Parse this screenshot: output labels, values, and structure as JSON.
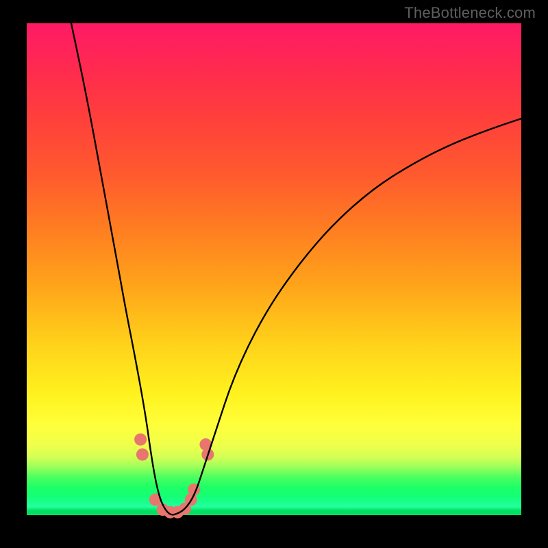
{
  "watermark": "TheBottleneck.com",
  "chart_data": {
    "type": "line",
    "title": "",
    "xlabel": "",
    "ylabel": "",
    "xlim": [
      0,
      100
    ],
    "ylim": [
      0,
      100
    ],
    "grid": false,
    "legend": false,
    "series": [
      {
        "name": "bottleneck-curve",
        "x": [
          9,
          12,
          15,
          18,
          20,
          22,
          24,
          25,
          26,
          27,
          28,
          29,
          30,
          32,
          34,
          36,
          38,
          42,
          48,
          55,
          62,
          70,
          78,
          86,
          94,
          100
        ],
        "values": [
          100,
          86,
          70,
          54,
          43,
          33,
          22,
          15,
          9,
          5,
          3,
          2,
          2,
          3,
          6,
          12,
          18,
          30,
          42,
          52,
          60,
          67,
          72,
          76,
          79,
          81
        ]
      }
    ],
    "markers": {
      "name": "salmon-dots",
      "points": [
        {
          "x": 23.0,
          "y": 17
        },
        {
          "x": 23.4,
          "y": 14
        },
        {
          "x": 26.0,
          "y": 5
        },
        {
          "x": 27.5,
          "y": 3
        },
        {
          "x": 29.0,
          "y": 2.5
        },
        {
          "x": 30.5,
          "y": 2.5
        },
        {
          "x": 32.0,
          "y": 3.2
        },
        {
          "x": 33.2,
          "y": 5
        },
        {
          "x": 33.8,
          "y": 7
        },
        {
          "x": 36.2,
          "y": 16
        },
        {
          "x": 36.6,
          "y": 14
        }
      ],
      "radius": 9,
      "color": "#e8766e"
    }
  },
  "colors": {
    "background": "#000000",
    "curve": "#000000",
    "marker": "#e8766e",
    "watermark": "#5f5f5f"
  }
}
